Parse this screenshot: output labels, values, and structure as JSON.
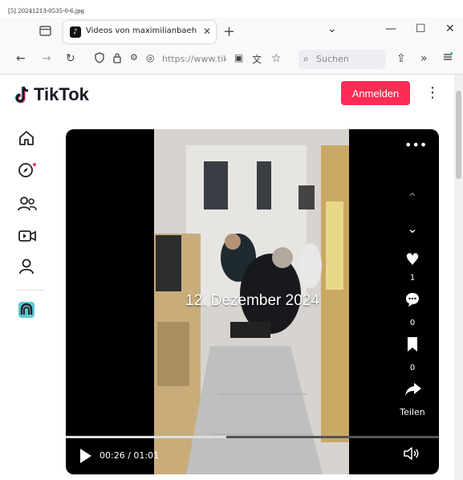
{
  "filename": "[5] 20241213-0535-0-6.jpg",
  "browser": {
    "tab_title": "Videos von maximilianbaehring",
    "new_tab_label": "+",
    "url": "https://www.tiktok",
    "search_placeholder": "Suchen",
    "minimize": "—",
    "maximize": "☐",
    "close": "✕"
  },
  "app": {
    "logo_text": "TikTok",
    "login_label": "Anmelden"
  },
  "video": {
    "overlay_text": "12. Dezember 2024",
    "likes": "1",
    "comments": "0",
    "saves": "0",
    "share_label": "Teilen",
    "time": "00:26 / 01:01",
    "progress": 0.43
  },
  "colors": {
    "brand": "#fe2c55",
    "notification_dot": "#fe2c55"
  }
}
